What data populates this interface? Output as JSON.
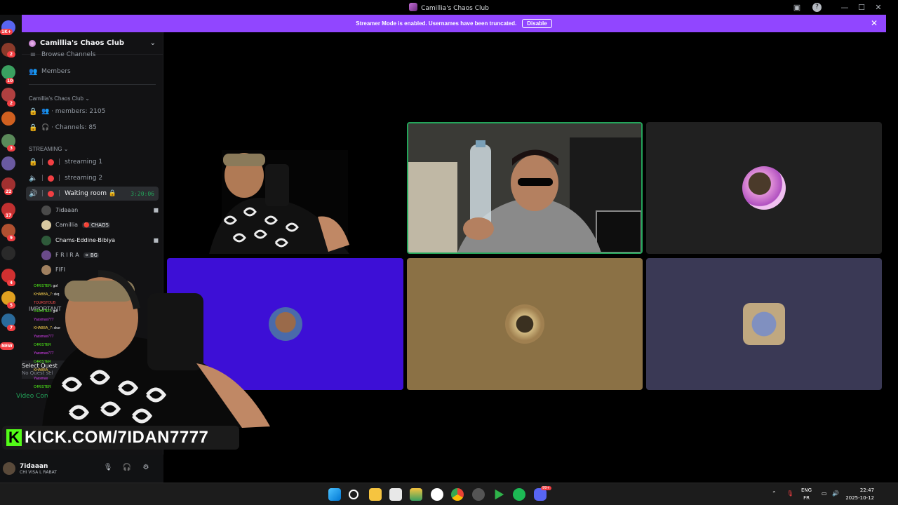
{
  "window": {
    "title": "Camillia's Chaos Club",
    "buttons": {
      "inbox": "▣",
      "help": "?",
      "minimize": "—",
      "maximize": "☐",
      "close": "✕"
    }
  },
  "banner": {
    "message": "Streamer Mode is enabled. Usernames have been truncated.",
    "disable_label": "Disable",
    "close": "✕"
  },
  "rail": {
    "badges": [
      "1K+",
      "2",
      "10",
      "2",
      "3",
      "22",
      "17",
      "9",
      "4",
      "5",
      "7",
      "NEW"
    ]
  },
  "sidebar": {
    "server_name": "Camillia's Chaos Club",
    "top_items": [
      {
        "label": "Browse Channels",
        "icon": "browse-icon"
      },
      {
        "label": "Members",
        "icon": "members-icon"
      }
    ],
    "category_info": "Camillia's Chaos Club ⌄",
    "info_channels": [
      {
        "label": "👥 · members: 2105",
        "icon": "lock-icon"
      },
      {
        "label": "🎧 · Channels: 85",
        "icon": "lock-icon"
      }
    ],
    "category_streaming": "STREAMING ⌄",
    "voice_channels": [
      {
        "label": "streaming 1",
        "icon": "lock-icon"
      },
      {
        "label": "streaming 2",
        "icon": "speaker-icon"
      },
      {
        "label": "Waiting room 🔒",
        "icon": "speaker-icon",
        "timer": "3:20:06"
      }
    ],
    "voice_users": [
      {
        "name": "7idaaan",
        "tag": "",
        "camera": true,
        "color": "#4a4a4a"
      },
      {
        "name": "Camillia",
        "tag": "🔴 CHAOS",
        "camera": false,
        "color": "#d8c8a0"
      },
      {
        "name": "Chams-Eddine-Bibiya",
        "tag": "",
        "camera": true,
        "color": "#2e5a3a"
      },
      {
        "name": "F R I R A",
        "tag": "⚪ BG",
        "camera": false,
        "color": "#6a4a8a"
      },
      {
        "name": "FIFI",
        "tag": "",
        "camera": false,
        "color": "#a08060"
      }
    ],
    "partial_labels": {
      "important": "IMPORTANT",
      "quest_title": "Select Quest",
      "quest_sub": "No Quest sel",
      "video_connected": "Video Conn"
    }
  },
  "user_panel": {
    "name": "7idaaan",
    "status": "CHI VISA L RABAT",
    "mic": "🎙",
    "headphones": "🎧",
    "settings": "⚙"
  },
  "overlay": {
    "kick_logo": "K",
    "kick_url": "KICK.COM/7IDAN7777",
    "chat_lines": [
      {
        "user": "C4RISTER",
        "msg": ": gol"
      },
      {
        "user": "KHABBA_7",
        "msg": ": xkq"
      },
      {
        "user": "TOURSTOUB",
        "msg": ""
      },
      {
        "user": "C4RISTER",
        "msg": ": gol"
      },
      {
        "user": "Yassmax777",
        "msg": ""
      },
      {
        "user": "KHABBA_7",
        "msg": ": xkor"
      },
      {
        "user": "Yassmax777",
        "msg": ""
      },
      {
        "user": "C4RISTER",
        "msg": ""
      },
      {
        "user": "Yassmax777",
        "msg": ""
      },
      {
        "user": "C4RISTER",
        "msg": ""
      },
      {
        "user": "KHABBA_",
        "msg": ""
      },
      {
        "user": "Yassmax",
        "msg": ""
      },
      {
        "user": "C4RISTER",
        "msg": ""
      }
    ]
  },
  "tiles": [
    {
      "kind": "camera",
      "who": "streamer",
      "bg": "#000000"
    },
    {
      "kind": "camera",
      "who": "speaking",
      "bg": "#2a2a2a",
      "speaking": true
    },
    {
      "kind": "avatar",
      "bg": "#202020",
      "avatar_color": "#d070c0"
    },
    {
      "kind": "avatar",
      "bg": "#3d0fd6",
      "avatar_color": "#8a5a3a"
    },
    {
      "kind": "avatar",
      "bg": "#8b7145",
      "avatar_color": "#c0a070"
    },
    {
      "kind": "avatar",
      "bg": "#3a3955",
      "avatar_color": "#8090b0"
    }
  ],
  "taskbar": {
    "apps": [
      "start",
      "search",
      "files",
      "store",
      "app",
      "obs",
      "chrome",
      "chrome-2",
      "app-green",
      "spotify",
      "discord"
    ],
    "discord_badge": "99+",
    "language": "ENG",
    "layout": "FR",
    "time": "22:47",
    "date": "2025-10-12"
  },
  "colors": {
    "accent": "#9146ff",
    "kick_green": "#53fc18",
    "speaking": "#23a55a",
    "danger": "#f23f43"
  }
}
